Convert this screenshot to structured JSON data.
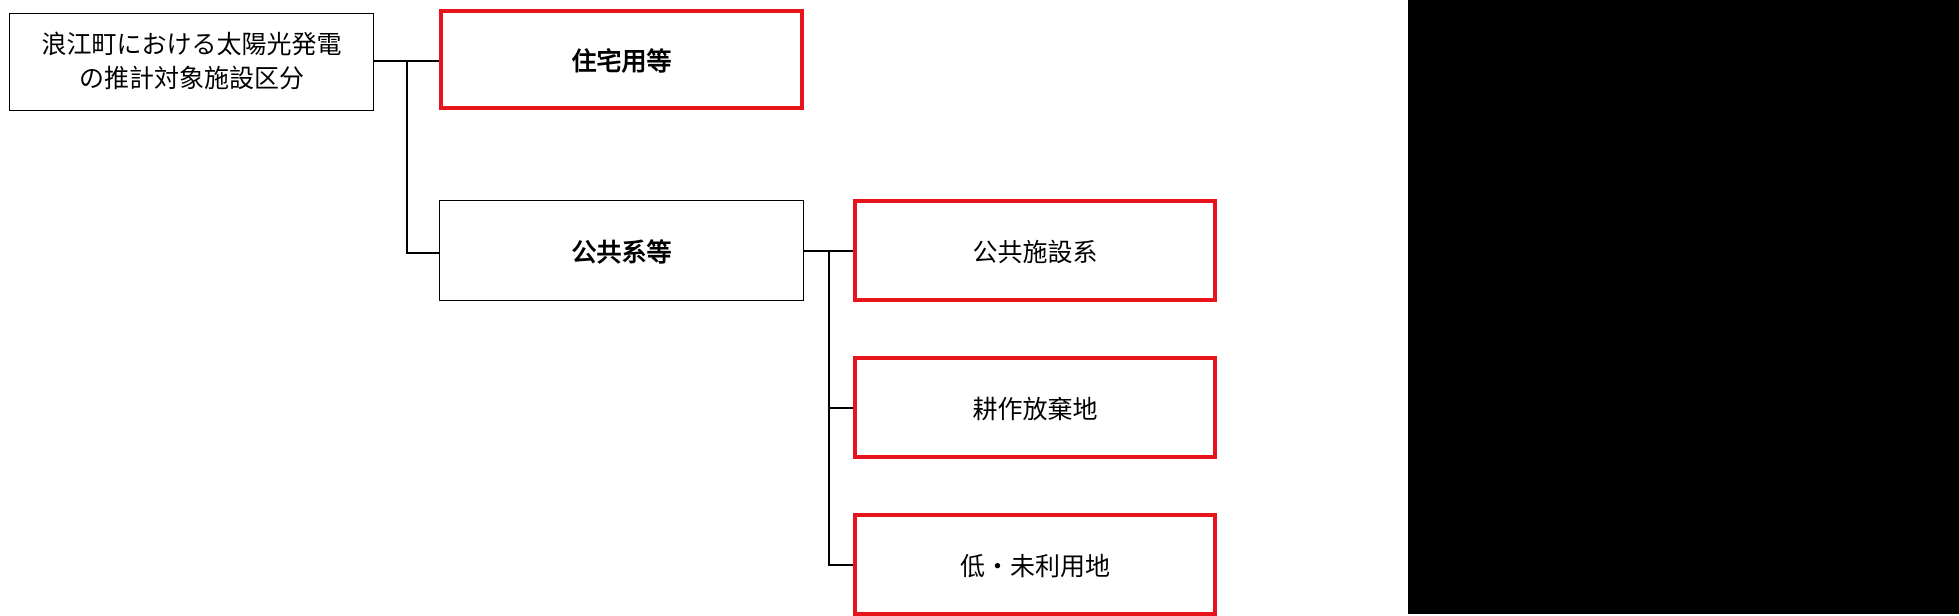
{
  "diagram": {
    "root": {
      "label": "浪江町における太陽光発電の推計対象施設区分",
      "line1": "浪江町における太陽光発電",
      "line2": "の推計対象施設区分"
    },
    "branches": [
      {
        "label": "住宅用等",
        "highlight": true
      },
      {
        "label": "公共系等",
        "highlight": false,
        "children": [
          {
            "label": "公共施設系",
            "highlight": true
          },
          {
            "label": "耕作放棄地",
            "highlight": true
          },
          {
            "label": "低・未利用地",
            "highlight": true
          }
        ]
      }
    ]
  },
  "colors": {
    "highlight_border": "#e8141c",
    "line": "#000000",
    "right_panel": "#000000"
  }
}
